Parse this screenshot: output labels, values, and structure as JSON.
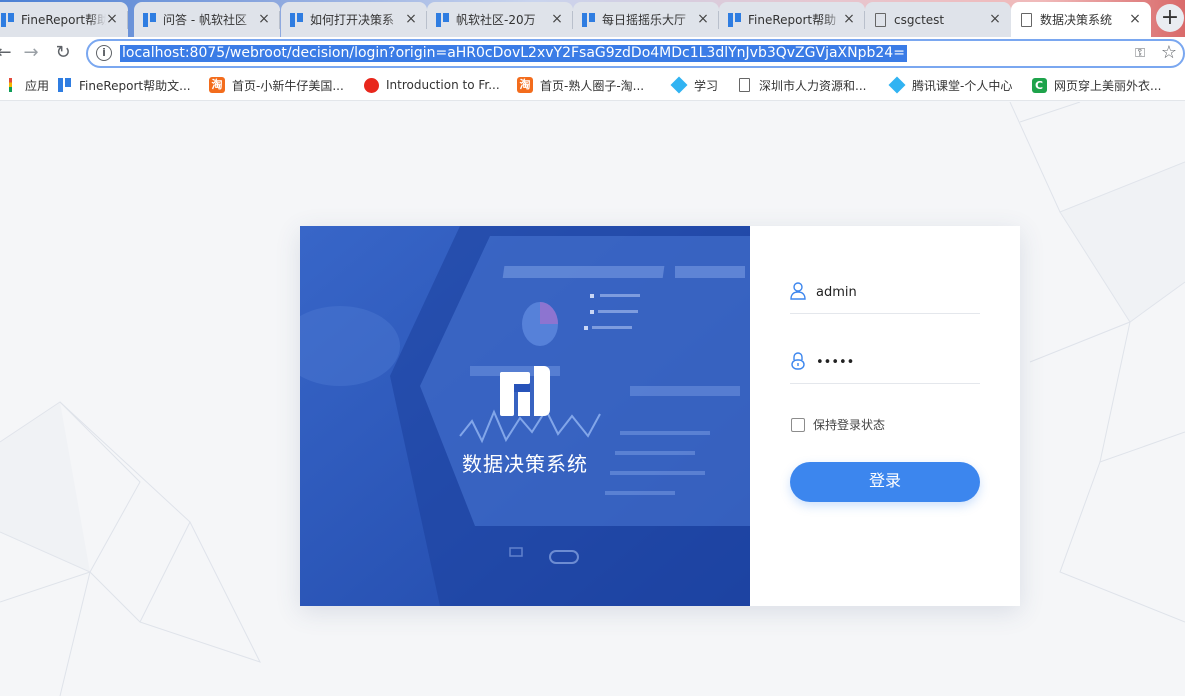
{
  "browser": {
    "tabs": [
      {
        "title": "FineReport帮助",
        "icon": "finereport-icon",
        "active": false
      },
      {
        "title": "问答 - 帆软社区",
        "icon": "finereport-icon",
        "active": false
      },
      {
        "title": "如何打开决策系",
        "icon": "finereport-icon",
        "active": false
      },
      {
        "title": "帆软社区-20万",
        "icon": "finereport-icon",
        "active": false
      },
      {
        "title": "每日摇摇乐大厅",
        "icon": "finereport-icon",
        "active": false
      },
      {
        "title": "FineReport帮助",
        "icon": "finereport-icon",
        "active": false
      },
      {
        "title": "csgctest",
        "icon": "document-icon",
        "active": false
      },
      {
        "title": "数据决策系统",
        "icon": "document-icon",
        "active": true
      }
    ],
    "tab_close_glyph": "×",
    "new_tab_glyph": "+",
    "url": "localhost:8075/webroot/decision/login?origin=aHR0cDovL2xvY2FsaG9zdDo4MDc1L3dlYnJvb3QvZGVjaXNpb24=",
    "bookmarks": [
      {
        "label": "应用",
        "icon": "apps-icon"
      },
      {
        "label": "FineReport帮助文...",
        "icon": "finereport-icon"
      },
      {
        "label": "首页-小新牛仔美国...",
        "icon": "taobao-icon"
      },
      {
        "label": "Introduction to Fr...",
        "icon": "red-circle-icon"
      },
      {
        "label": "首页-熟人圈子-淘...",
        "icon": "taobao-icon"
      },
      {
        "label": "学习",
        "icon": "diamond-icon"
      },
      {
        "label": "深圳市人力资源和...",
        "icon": "document-icon"
      },
      {
        "label": "腾讯课堂-个人中心",
        "icon": "diamond-icon"
      },
      {
        "label": "网页穿上美丽外衣...",
        "icon": "green-c-icon"
      }
    ]
  },
  "login": {
    "brand_name": "数据决策系统",
    "username": "admin",
    "password": "12345",
    "remember_label": "保持登录状态",
    "login_button": "登录"
  },
  "colors": {
    "hero_blue": "#2753b9",
    "button_blue": "#3c86ee",
    "url_highlight": "#3b7ce6"
  }
}
